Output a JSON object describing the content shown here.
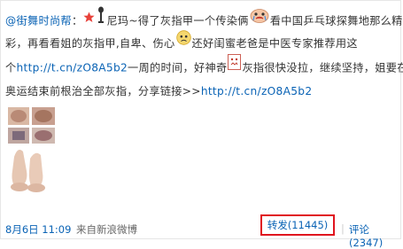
{
  "post": {
    "author": "@街舞时尚帮",
    "separator": "：",
    "line1_a": "尼玛~得了灰指甲一个传染俩",
    "line1_b": "看中国乒乓球探舞地那么精",
    "line2_a": "彩，再看看姐的灰指甲,自卑、伤心",
    "line2_b": "还好闺蜜老爸是中医专家推荐用这",
    "line3_a": "个",
    "link1": "http://t.cn/zO8A5b2",
    "line3_b": "一周的时间，好神奇",
    "line3_c": "灰指很快没拉，继续坚持，姐要在",
    "line4_a": "奥运结束前根治全部灰指，分享链接>>",
    "link2": "http://t.cn/zO8A5b2"
  },
  "footer": {
    "timestamp": "8月6日 11:09",
    "source": "来自新浪微博",
    "repost": "转发(11445)",
    "divider": "|",
    "comment": "评论(2347)"
  },
  "colors": {
    "link": "#0a63b5",
    "highlight_border": "#e0141e"
  }
}
